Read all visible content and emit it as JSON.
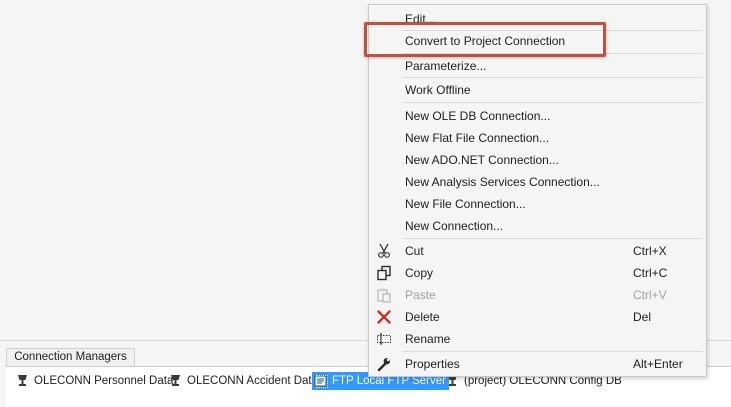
{
  "context_menu": {
    "items": [
      {
        "label": "Edit...",
        "shortcut": "",
        "icon": "",
        "disabled": false
      },
      {
        "label": "Convert to Project Connection",
        "shortcut": "",
        "icon": "",
        "disabled": false
      },
      {
        "label": "Parameterize...",
        "shortcut": "",
        "icon": "",
        "disabled": false
      },
      {
        "label": "Work Offline",
        "shortcut": "",
        "icon": "",
        "disabled": false
      },
      {
        "label": "New OLE DB Connection...",
        "shortcut": "",
        "icon": "",
        "disabled": false
      },
      {
        "label": "New Flat File Connection...",
        "shortcut": "",
        "icon": "",
        "disabled": false
      },
      {
        "label": "New ADO.NET Connection...",
        "shortcut": "",
        "icon": "",
        "disabled": false
      },
      {
        "label": "New Analysis Services Connection...",
        "shortcut": "",
        "icon": "",
        "disabled": false
      },
      {
        "label": "New File Connection...",
        "shortcut": "",
        "icon": "",
        "disabled": false
      },
      {
        "label": "New Connection...",
        "shortcut": "",
        "icon": "",
        "disabled": false
      },
      {
        "label": "Cut",
        "shortcut": "Ctrl+X",
        "icon": "scissors-icon",
        "disabled": false
      },
      {
        "label": "Copy",
        "shortcut": "Ctrl+C",
        "icon": "copy-icon",
        "disabled": false
      },
      {
        "label": "Paste",
        "shortcut": "Ctrl+V",
        "icon": "paste-icon",
        "disabled": true
      },
      {
        "label": "Delete",
        "shortcut": "Del",
        "icon": "delete-x-icon",
        "disabled": false
      },
      {
        "label": "Rename",
        "shortcut": "",
        "icon": "rename-icon",
        "disabled": false
      },
      {
        "label": "Properties",
        "shortcut": "Alt+Enter",
        "icon": "wrench-icon",
        "disabled": false
      }
    ]
  },
  "connection_managers": {
    "tab_label": "Connection Managers",
    "items": [
      {
        "label": "OLECONN Personnel Data",
        "icon": "database-connection-icon",
        "selected": false
      },
      {
        "label": "OLECONN Accident Data",
        "icon": "database-connection-icon",
        "selected": false
      },
      {
        "label": "FTP Local FTP Server",
        "icon": "ftp-connection-icon",
        "selected": true
      },
      {
        "label": "(project) OLECONN Config DB",
        "icon": "database-connection-icon",
        "selected": false
      }
    ]
  },
  "colors": {
    "highlight_border": "#c0503f",
    "selection_background": "#3399ff",
    "delete_icon": "#c8312a",
    "menu_background": "#f5f5f5"
  }
}
